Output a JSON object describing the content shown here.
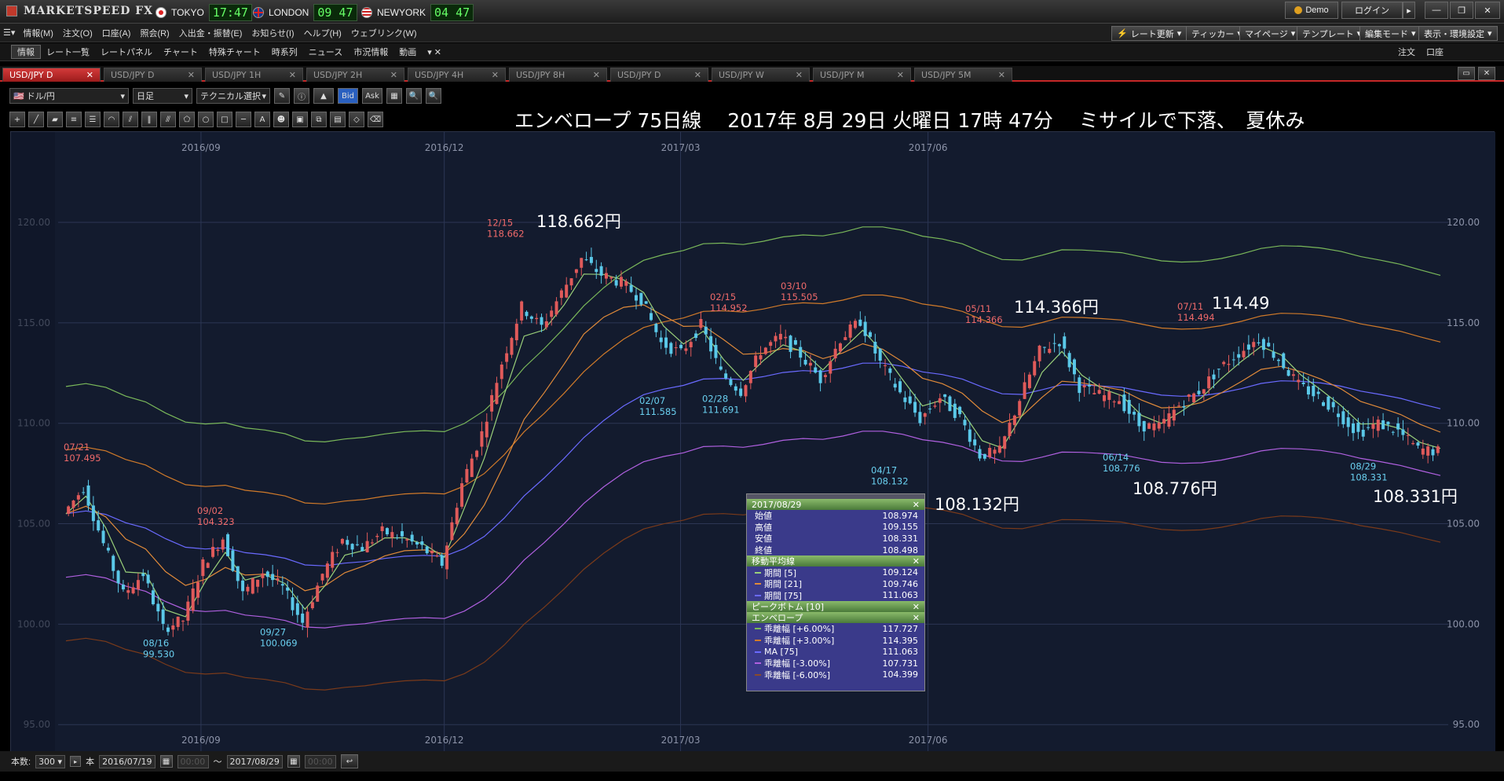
{
  "app": {
    "brand": "MARKETSPEED FX",
    "demo": "Demo",
    "login": "ログイン"
  },
  "clocks": [
    {
      "city": "TOKYO",
      "time": "17:47"
    },
    {
      "city": "LONDON",
      "time": "09 47"
    },
    {
      "city": "NEWYORK",
      "time": "04 47"
    }
  ],
  "menu": [
    "情報(M)",
    "注文(O)",
    "口座(A)",
    "照会(R)",
    "入出金・振替(E)",
    "お知らせ(I)",
    "ヘルプ(H)",
    "ウェブリンク(W)"
  ],
  "right_menu": [
    "レート更新",
    "ティッカー",
    "マイページ",
    "テンプレート",
    "編集モード",
    "表示・環境設定"
  ],
  "toolbar2": [
    "情報",
    "レート一覧",
    "レートパネル",
    "チャート",
    "特殊チャート",
    "時系列",
    "ニュース",
    "市況情報",
    "動画"
  ],
  "toolbar2_right": [
    "注文",
    "口座"
  ],
  "tabs": [
    "USD/JPY D",
    "USD/JPY D",
    "USD/JPY 1H",
    "USD/JPY 2H",
    "USD/JPY 4H",
    "USD/JPY 8H",
    "USD/JPY D",
    "USD/JPY W",
    "USD/JPY M",
    "USD/JPY 5M"
  ],
  "controls": {
    "currency": "ドル/円",
    "period": "日足",
    "tech": "テクニカル選択",
    "bid": "Bid",
    "ask": "Ask"
  },
  "headline": "エンベロープ 75日線　 2017年 8月 29日 火曜日 17時 47分　 ミサイルで下落、　夏休み",
  "bottom": {
    "count_label": "本数:",
    "count": "300",
    "unit": "本",
    "from": "2016/07/19",
    "to": "2017/08/29",
    "sep": "～"
  },
  "popup": {
    "date": "2017/08/29",
    "ohlc": [
      {
        "k": "始値",
        "v": "108.974"
      },
      {
        "k": "高値",
        "v": "109.155"
      },
      {
        "k": "安値",
        "v": "108.331"
      },
      {
        "k": "終値",
        "v": "108.498"
      }
    ],
    "ma_title": "移動平均線",
    "ma": [
      {
        "k": "期間 [5]",
        "v": "109.124",
        "c": "#9ad07a"
      },
      {
        "k": "期間 [21]",
        "v": "109.746",
        "c": "#e08a3a"
      },
      {
        "k": "期間 [75]",
        "v": "111.063",
        "c": "#6a6aff"
      }
    ],
    "peak_title": "ピークボトム [10]",
    "env_title": "エンベロープ",
    "env": [
      {
        "k": "乖離幅 [+6.00%]",
        "v": "117.727",
        "c": "#7ab85a"
      },
      {
        "k": "乖離幅 [+3.00%]",
        "v": "114.395",
        "c": "#d07a2a"
      },
      {
        "k": "MA [75]",
        "v": "111.063",
        "c": "#6a6aff"
      },
      {
        "k": "乖離幅 [-3.00%]",
        "v": "107.731",
        "c": "#b060e0"
      },
      {
        "k": "乖離幅 [-6.00%]",
        "v": "104.399",
        "c": "#8a4a2a"
      }
    ]
  },
  "big_labels": [
    "118.662円",
    "114.366円",
    "114.49",
    "108.132円",
    "108.776円",
    "108.331円"
  ],
  "chart_data": {
    "type": "line",
    "x_ticks": [
      "2016/09",
      "2016/12",
      "2017/03",
      "2017/06"
    ],
    "y_ticks": [
      "120.00",
      "115.00",
      "110.00",
      "105.00",
      "100.00",
      "95.00"
    ],
    "ylim": [
      93.6,
      124.5
    ],
    "grid": true,
    "peaks": [
      {
        "date": "07/21",
        "value": "107.495",
        "type": "high"
      },
      {
        "date": "08/16",
        "value": "99.530",
        "type": "low"
      },
      {
        "date": "09/02",
        "value": "104.323",
        "type": "high"
      },
      {
        "date": "09/27",
        "value": "100.069",
        "type": "low"
      },
      {
        "date": "12/15",
        "value": "118.662",
        "type": "high"
      },
      {
        "date": "02/07",
        "value": "111.585",
        "type": "low"
      },
      {
        "date": "02/15",
        "value": "114.952",
        "type": "high"
      },
      {
        "date": "02/28",
        "value": "111.691",
        "type": "low"
      },
      {
        "date": "03/10",
        "value": "115.505",
        "type": "high"
      },
      {
        "date": "04/17",
        "value": "108.132",
        "type": "low"
      },
      {
        "date": "05/11",
        "value": "114.366",
        "type": "high"
      },
      {
        "date": "06/14",
        "value": "108.776",
        "type": "low"
      },
      {
        "date": "07/11",
        "value": "114.494",
        "type": "high"
      },
      {
        "date": "08/29",
        "value": "108.331",
        "type": "low"
      }
    ],
    "price_path": [
      105.5,
      106.8,
      104,
      101.5,
      102.5,
      99.8,
      100.2,
      103,
      104.3,
      101.5,
      102.6,
      101.8,
      100.1,
      102.5,
      104.2,
      103.8,
      104.6,
      104.3,
      103.8,
      103,
      107,
      109.5,
      113,
      115.8,
      114.8,
      116.5,
      118.2,
      117.4,
      117,
      116.2,
      114,
      113.5,
      114.9,
      112.5,
      111.6,
      113.6,
      114.3,
      113.4,
      112.2,
      114.2,
      115.1,
      113,
      111.5,
      110.2,
      111.3,
      110.3,
      108.4,
      108.6,
      111.2,
      113.6,
      114.1,
      111.8,
      111.4,
      111.2,
      109.9,
      109.8,
      110.9,
      111.6,
      112.7,
      113.5,
      114.2,
      113.2,
      111.9,
      111.3,
      110.5,
      109.5,
      110,
      109.6,
      108.7,
      108.6
    ]
  },
  "colors": {
    "chart_bg": "#131b2e",
    "up": "#e05a5a",
    "down": "#5ac8e8",
    "ma5": "#9ad07a",
    "ma21": "#e08a3a",
    "ma75": "#6a6aff",
    "env_p6": "#7ab85a",
    "env_p3": "#d07a2a",
    "env_m3": "#b060e0",
    "env_m6": "#7a3a1a"
  }
}
